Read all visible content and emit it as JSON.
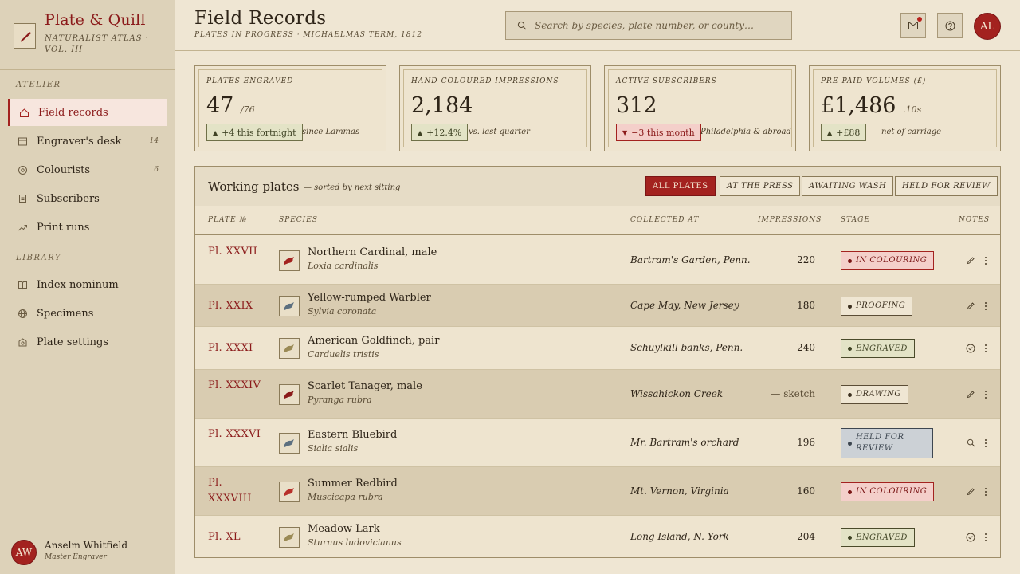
{
  "brand": {
    "title": "Plate & Quill",
    "subtitle": "Naturalist Atlas · Vol. III"
  },
  "nav": {
    "section_atelier": "Atelier",
    "section_library": "Library",
    "items": [
      {
        "label": "Field records",
        "count": "",
        "icon": "home-icon",
        "active": true
      },
      {
        "label": "Engraver's desk",
        "count": "14",
        "icon": "desk-icon"
      },
      {
        "label": "Colourists",
        "count": "6",
        "icon": "palette-icon"
      },
      {
        "label": "Subscribers",
        "count": "",
        "icon": "ledger-icon"
      },
      {
        "label": "Print runs",
        "count": "",
        "icon": "trend-icon"
      },
      {
        "label": "Index nominum",
        "count": "",
        "icon": "book-icon"
      },
      {
        "label": "Specimens",
        "count": "",
        "icon": "globe-icon"
      },
      {
        "label": "Plate settings",
        "count": "",
        "icon": "settings-icon"
      }
    ]
  },
  "user": {
    "initials": "AW",
    "name": "Anselm Whitfield",
    "role": "Master Engraver"
  },
  "header": {
    "title": "Field Records",
    "subtitle": "Plates in progress · Michaelmas Term, 1812",
    "search_placeholder": "Search by species, plate number, or county…",
    "avatar_initials": "AL"
  },
  "stats": [
    {
      "label": "Plates engraved",
      "value": "47",
      "suffix": "/76",
      "delta": "+4 this fortnight",
      "trend": "up",
      "note": "since Lammas"
    },
    {
      "label": "Hand-coloured impressions",
      "value": "2,184",
      "suffix": "",
      "delta": "+12.4%",
      "trend": "up",
      "note": "vs. last quarter"
    },
    {
      "label": "Active subscribers",
      "value": "312",
      "suffix": "",
      "delta": "−3 this month",
      "trend": "down",
      "note": "Philadelphia & abroad"
    },
    {
      "label": "Pre-paid volumes (£)",
      "value": "£1,486",
      "suffix": ".10s",
      "delta": "+£88",
      "trend": "up",
      "note": "net of carriage"
    }
  ],
  "table": {
    "title": "Working plates",
    "subtitle": "— sorted by next sitting",
    "filters": [
      "All plates",
      "At the press",
      "Awaiting wash",
      "Held for review"
    ],
    "columns": [
      "Plate №",
      "Species",
      "Collected at",
      "Impressions",
      "Stage",
      "Notes"
    ],
    "rows": [
      {
        "plate": "Pl. XXVII",
        "name": "Northern Cardinal, male",
        "latin": "Loxia cardinalis",
        "location": "Bartram's Garden, Penn.",
        "impressions": "220",
        "stage": "In colouring",
        "stage_kind": "colour",
        "bird_color": "#a3221f",
        "action": "edit-icon"
      },
      {
        "plate": "Pl. XXIX",
        "name": "Yellow-rumped Warbler",
        "latin": "Sylvia coronata",
        "location": "Cape May, New Jersey",
        "impressions": "180",
        "stage": "Proofing",
        "stage_kind": "proof",
        "bird_color": "#5c6f7f",
        "action": "edit-icon"
      },
      {
        "plate": "Pl. XXXI",
        "name": "American Goldfinch, pair",
        "latin": "Carduelis tristis",
        "location": "Schuylkill banks, Penn.",
        "impressions": "240",
        "stage": "Engraved",
        "stage_kind": "engr",
        "bird_color": "#9a8a55",
        "action": "check-icon"
      },
      {
        "plate": "Pl. XXXIV",
        "name": "Scarlet Tanager, male",
        "latin": "Pyranga rubra",
        "location": "Wissahickon Creek",
        "impressions": "— sketch",
        "stage": "Drawing",
        "stage_kind": "proof",
        "bird_color": "#8b1a1a",
        "action": "edit-icon"
      },
      {
        "plate": "Pl. XXXVI",
        "name": "Eastern Bluebird",
        "latin": "Sialia sialis",
        "location": "Mr. Bartram's orchard",
        "impressions": "196",
        "stage": "Held for review",
        "stage_kind": "review",
        "bird_color": "#5c6f7f",
        "action": "search-icon"
      },
      {
        "plate": "Pl. XXXVIII",
        "name": "Summer Redbird",
        "latin": "Muscicapa rubra",
        "location": "Mt. Vernon, Virginia",
        "impressions": "160",
        "stage": "In colouring",
        "stage_kind": "colour",
        "bird_color": "#b8302a",
        "action": "edit-icon"
      },
      {
        "plate": "Pl. XL",
        "name": "Meadow Lark",
        "latin": "Sturnus ludovicianus",
        "location": "Long Island, N. York",
        "impressions": "204",
        "stage": "Engraved",
        "stage_kind": "engr",
        "bird_color": "#9a8a55",
        "action": "check-icon"
      }
    ]
  },
  "colors": {
    "accent": "#a3221f",
    "parchment": "#efe6d3",
    "sidebar": "#ddd2b9",
    "ink": "#2e2418"
  }
}
